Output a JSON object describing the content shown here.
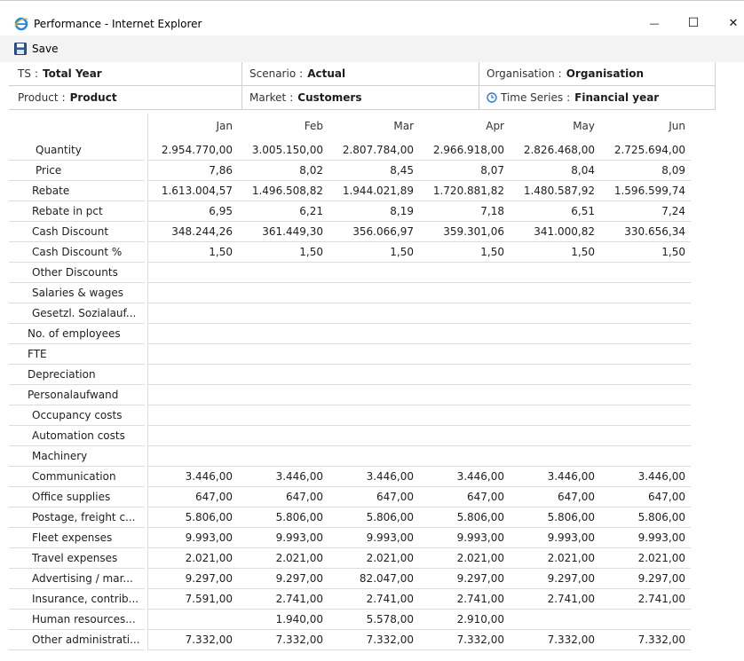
{
  "window": {
    "title": "Performance - Internet Explorer",
    "minimize_glyph": "—",
    "maximize_glyph": "☐",
    "close_glyph": "✕",
    "app_icon": "internet-explorer-icon"
  },
  "toolbar": {
    "save_label": "Save",
    "save_icon": "floppy-disk-icon"
  },
  "header": {
    "ts": {
      "label": "TS",
      "value": "Total Year"
    },
    "scenario": {
      "label": "Scenario",
      "value": "Actual"
    },
    "organisation": {
      "label": "Organisation",
      "value": "Organisation"
    },
    "product": {
      "label": "Product",
      "value": "Product"
    },
    "market": {
      "label": "Market",
      "value": "Customers"
    },
    "time_series": {
      "label": "Time Series",
      "value": "Financial year",
      "icon": "clock-icon"
    },
    "separator": ":"
  },
  "grid": {
    "months": [
      "Jan",
      "Feb",
      "Mar",
      "Apr",
      "May",
      "Jun"
    ],
    "rows": [
      {
        "label": "Quantity",
        "values": [
          "2.954.770,00",
          "3.005.150,00",
          "2.807.784,00",
          "2.966.918,00",
          "2.826.468,00",
          "2.725.694,00"
        ]
      },
      {
        "label": "Price",
        "values": [
          "7,86",
          "8,02",
          "8,45",
          "8,07",
          "8,04",
          "8,09"
        ]
      },
      {
        "label": "Rebate",
        "values": [
          "1.613.004,57",
          "1.496.508,82",
          "1.944.021,89",
          "1.720.881,82",
          "1.480.587,92",
          "1.596.599,74"
        ]
      },
      {
        "label": "Rebate in pct",
        "values": [
          "6,95",
          "6,21",
          "8,19",
          "7,18",
          "6,51",
          "7,24"
        ]
      },
      {
        "label": "Cash Discount",
        "values": [
          "348.244,26",
          "361.449,30",
          "356.066,97",
          "359.301,06",
          "341.000,82",
          "330.656,34"
        ]
      },
      {
        "label": "Cash Discount %",
        "values": [
          "1,50",
          "1,50",
          "1,50",
          "1,50",
          "1,50",
          "1,50"
        ]
      },
      {
        "label": "Other Discounts",
        "values": [
          "",
          "",
          "",
          "",
          "",
          ""
        ]
      },
      {
        "label": "Salaries & wages",
        "values": [
          "",
          "",
          "",
          "",
          "",
          ""
        ]
      },
      {
        "label": "Gesetzl. Sozialauf...",
        "values": [
          "",
          "",
          "",
          "",
          "",
          ""
        ]
      },
      {
        "label": "No. of employees",
        "values": [
          "",
          "",
          "",
          "",
          "",
          ""
        ]
      },
      {
        "label": "FTE",
        "values": [
          "",
          "",
          "",
          "",
          "",
          ""
        ]
      },
      {
        "label": "Depreciation",
        "values": [
          "",
          "",
          "",
          "",
          "",
          ""
        ]
      },
      {
        "label": "Personalaufwand",
        "values": [
          "",
          "",
          "",
          "",
          "",
          ""
        ]
      },
      {
        "label": "Occupancy costs",
        "values": [
          "",
          "",
          "",
          "",
          "",
          ""
        ]
      },
      {
        "label": "Automation costs",
        "values": [
          "",
          "",
          "",
          "",
          "",
          ""
        ]
      },
      {
        "label": "Machinery",
        "values": [
          "",
          "",
          "",
          "",
          "",
          ""
        ]
      },
      {
        "label": "Communication",
        "values": [
          "3.446,00",
          "3.446,00",
          "3.446,00",
          "3.446,00",
          "3.446,00",
          "3.446,00"
        ]
      },
      {
        "label": "Office supplies",
        "values": [
          "647,00",
          "647,00",
          "647,00",
          "647,00",
          "647,00",
          "647,00"
        ]
      },
      {
        "label": "Postage,  freight c...",
        "values": [
          "5.806,00",
          "5.806,00",
          "5.806,00",
          "5.806,00",
          "5.806,00",
          "5.806,00"
        ]
      },
      {
        "label": "Fleet expenses",
        "values": [
          "9.993,00",
          "9.993,00",
          "9.993,00",
          "9.993,00",
          "9.993,00",
          "9.993,00"
        ]
      },
      {
        "label": "Travel expenses",
        "values": [
          "2.021,00",
          "2.021,00",
          "2.021,00",
          "2.021,00",
          "2.021,00",
          "2.021,00"
        ]
      },
      {
        "label": "Advertising  / mar...",
        "values": [
          "9.297,00",
          "9.297,00",
          "82.047,00",
          "9.297,00",
          "9.297,00",
          "9.297,00"
        ]
      },
      {
        "label": "Insurance,  contrib...",
        "values": [
          "7.591,00",
          "2.741,00",
          "2.741,00",
          "2.741,00",
          "2.741,00",
          "2.741,00"
        ]
      },
      {
        "label": "Human  resources...",
        "values": [
          "",
          "1.940,00",
          "5.578,00",
          "2.910,00",
          "",
          ""
        ]
      },
      {
        "label": "Other  administrati...",
        "values": [
          "7.332,00",
          "7.332,00",
          "7.332,00",
          "7.332,00",
          "7.332,00",
          "7.332,00"
        ]
      }
    ]
  }
}
